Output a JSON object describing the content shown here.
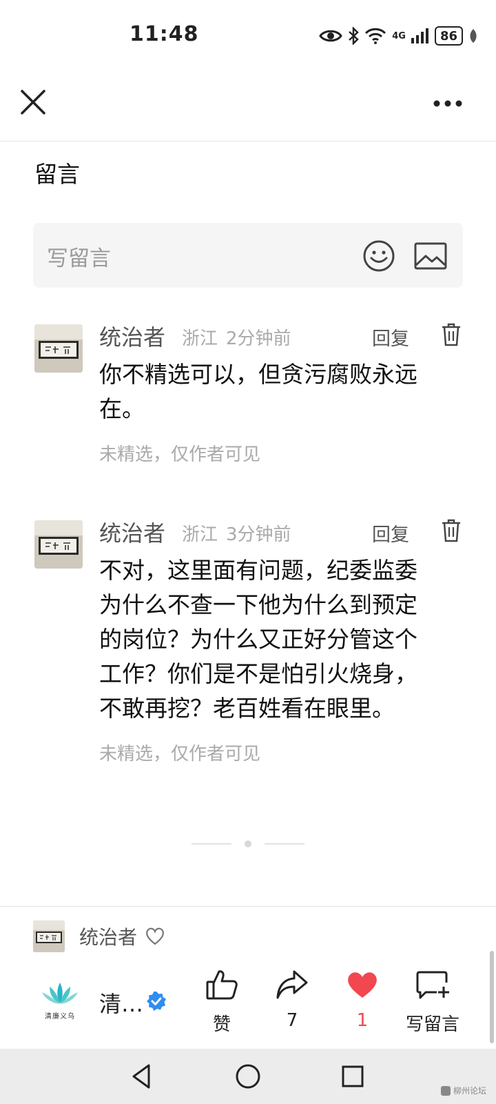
{
  "status_bar": {
    "time": "11:48",
    "network": "4G",
    "battery": "86"
  },
  "header": {
    "section_title": "留言"
  },
  "comment_input": {
    "placeholder": "写留言"
  },
  "comments": [
    {
      "author": "统治者",
      "location": "浙江",
      "time": "2分钟前",
      "reply_label": "回复",
      "lines": [
        "你不精选可以，但贪污腐败永远",
        "在。"
      ],
      "status": "未精选，仅作者可见"
    },
    {
      "author": "统治者",
      "location": "浙江",
      "time": "3分钟前",
      "reply_label": "回复",
      "lines": [
        "不对，这里面有问题，纪委监委",
        "为什么不查一下他为什么到预定",
        "的岗位？为什么又正好分管这个",
        "工作？你们是不是怕引火烧身，",
        "不敢再挖？老百姓看在眼里。"
      ],
      "status": "未精选，仅作者可见"
    }
  ],
  "current_user": {
    "name": "统治者"
  },
  "account": {
    "logo_text": "清廉义乌",
    "name": "清…"
  },
  "actions": {
    "like_label": "赞",
    "share_count": "7",
    "favorite_count": "1",
    "comment_label": "写留言"
  },
  "colors": {
    "accent_red": "#f2474f",
    "verified_blue": "#2f8cf0",
    "logo_teal": "#2bb3c6"
  },
  "watermark": "柳州论坛"
}
